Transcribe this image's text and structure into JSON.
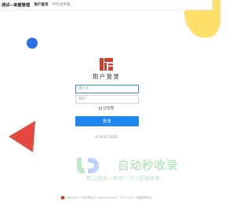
{
  "header": {
    "brand": "测试--单据管理",
    "nav": [
      "用户首页",
      "平时高赞暖"
    ]
  },
  "login": {
    "title": "用户登录",
    "username_placeholder": "用户名",
    "password_placeholder": "密码",
    "remember_label": "记住我",
    "submit_label": "登录",
    "copyright": "© 2017-2022"
  },
  "watermark": {
    "title": "自动秒收录",
    "subtitle": "数上链接→来访一次→自动收录"
  },
  "footer": {
    "text": "Copyright © 测试单据 All rights reserved · 2017-2022 · 单据管理系统"
  },
  "colors": {
    "primary": "#1e88f0",
    "accent_red": "#e4493f",
    "accent_yellow": "#ffe06b",
    "accent_blue": "#2d6fe6",
    "watermark_green": "#37b24d"
  },
  "icons": [
    "app-logo-icon",
    "watermark-logo-icon",
    "footer-badge-icon"
  ]
}
